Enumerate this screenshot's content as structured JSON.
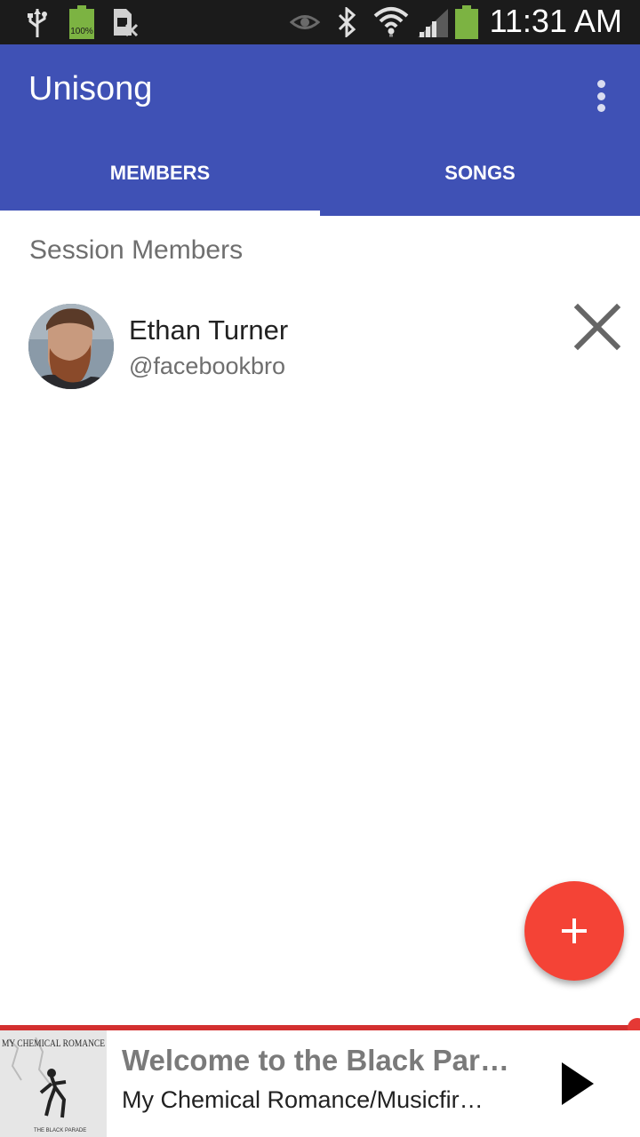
{
  "status_bar": {
    "battery_label": "100%",
    "time": "11:31 AM",
    "icons": [
      "usb-icon",
      "battery-full-icon",
      "sim-blocked-icon",
      "eye-icon",
      "bluetooth-icon",
      "wifi-icon",
      "signal-icon",
      "battery-icon"
    ]
  },
  "app_bar": {
    "title": "Unisong",
    "menu_icon": "overflow-menu-icon",
    "color": "#3f51b5"
  },
  "tabs": [
    {
      "label": "MEMBERS",
      "selected": true
    },
    {
      "label": "SONGS",
      "selected": false
    }
  ],
  "members_section": {
    "title": "Session Members",
    "members": [
      {
        "name": "Ethan Turner",
        "handle": "@facebookbro",
        "avatar": "user-photo",
        "action_icon": "close-icon"
      }
    ]
  },
  "fab": {
    "icon": "add-icon",
    "color": "#f44336"
  },
  "player": {
    "title": "Welcome to the Black Par…",
    "subtitle": "My Chemical Romance/Musicfir…",
    "album_art_text": "MY CHEMICAL ROMANCE",
    "album_art_subtext": "THE BLACK PARADE",
    "play_icon": "play-icon",
    "accent": "#d32f2f"
  }
}
